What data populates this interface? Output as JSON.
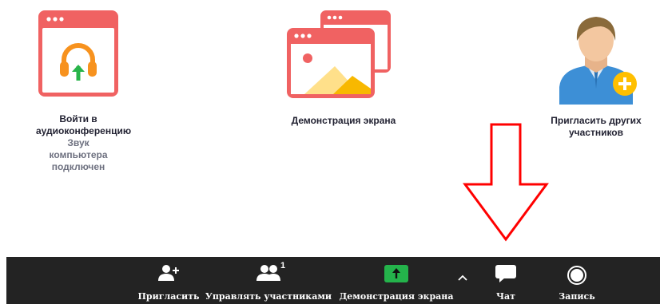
{
  "tiles": {
    "audio": {
      "title": "Войти в аудиоконференцию",
      "subtitle": "Звук компьютера подключен"
    },
    "share": {
      "title": "Демонстрация экрана"
    },
    "invite": {
      "title": "Пригласить других участников"
    }
  },
  "toolbar": {
    "invite_label": "Пригласить",
    "participants_label": "Управлять участниками",
    "participants_count": "1",
    "share_label": "Демонстрация экрана",
    "chat_label": "Чат",
    "record_label": "Запись"
  },
  "icons": {
    "audio": "headphones-icon",
    "share": "screen-share-icon",
    "invite": "avatar-add-icon",
    "tb_invite": "add-person-icon",
    "tb_participants": "participants-icon",
    "tb_share": "share-screen-icon",
    "tb_share_options": "chevron-up-icon",
    "tb_chat": "chat-bubble-icon",
    "tb_record": "record-icon",
    "annotation": "red-down-arrow-icon"
  },
  "colors": {
    "window_red": "#f06262",
    "toolbar_bg": "#232323",
    "share_green": "#24b34b",
    "headphone_orange": "#f7921e",
    "avatar_blue": "#3d8fd6",
    "badge_yellow": "#ffbf00"
  }
}
